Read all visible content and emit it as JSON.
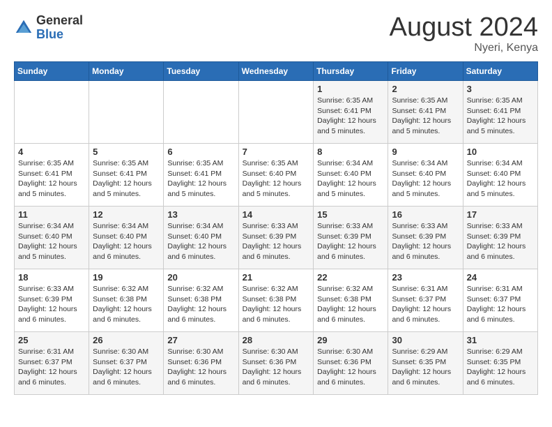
{
  "header": {
    "logo_general": "General",
    "logo_blue": "Blue",
    "month_year": "August 2024",
    "location": "Nyeri, Kenya"
  },
  "weekdays": [
    "Sunday",
    "Monday",
    "Tuesday",
    "Wednesday",
    "Thursday",
    "Friday",
    "Saturday"
  ],
  "weeks": [
    [
      {
        "day": "",
        "info": ""
      },
      {
        "day": "",
        "info": ""
      },
      {
        "day": "",
        "info": ""
      },
      {
        "day": "",
        "info": ""
      },
      {
        "day": "1",
        "info": "Sunrise: 6:35 AM\nSunset: 6:41 PM\nDaylight: 12 hours and 5 minutes."
      },
      {
        "day": "2",
        "info": "Sunrise: 6:35 AM\nSunset: 6:41 PM\nDaylight: 12 hours and 5 minutes."
      },
      {
        "day": "3",
        "info": "Sunrise: 6:35 AM\nSunset: 6:41 PM\nDaylight: 12 hours and 5 minutes."
      }
    ],
    [
      {
        "day": "4",
        "info": "Sunrise: 6:35 AM\nSunset: 6:41 PM\nDaylight: 12 hours and 5 minutes."
      },
      {
        "day": "5",
        "info": "Sunrise: 6:35 AM\nSunset: 6:41 PM\nDaylight: 12 hours and 5 minutes."
      },
      {
        "day": "6",
        "info": "Sunrise: 6:35 AM\nSunset: 6:41 PM\nDaylight: 12 hours and 5 minutes."
      },
      {
        "day": "7",
        "info": "Sunrise: 6:35 AM\nSunset: 6:40 PM\nDaylight: 12 hours and 5 minutes."
      },
      {
        "day": "8",
        "info": "Sunrise: 6:34 AM\nSunset: 6:40 PM\nDaylight: 12 hours and 5 minutes."
      },
      {
        "day": "9",
        "info": "Sunrise: 6:34 AM\nSunset: 6:40 PM\nDaylight: 12 hours and 5 minutes."
      },
      {
        "day": "10",
        "info": "Sunrise: 6:34 AM\nSunset: 6:40 PM\nDaylight: 12 hours and 5 minutes."
      }
    ],
    [
      {
        "day": "11",
        "info": "Sunrise: 6:34 AM\nSunset: 6:40 PM\nDaylight: 12 hours and 5 minutes."
      },
      {
        "day": "12",
        "info": "Sunrise: 6:34 AM\nSunset: 6:40 PM\nDaylight: 12 hours and 6 minutes."
      },
      {
        "day": "13",
        "info": "Sunrise: 6:34 AM\nSunset: 6:40 PM\nDaylight: 12 hours and 6 minutes."
      },
      {
        "day": "14",
        "info": "Sunrise: 6:33 AM\nSunset: 6:39 PM\nDaylight: 12 hours and 6 minutes."
      },
      {
        "day": "15",
        "info": "Sunrise: 6:33 AM\nSunset: 6:39 PM\nDaylight: 12 hours and 6 minutes."
      },
      {
        "day": "16",
        "info": "Sunrise: 6:33 AM\nSunset: 6:39 PM\nDaylight: 12 hours and 6 minutes."
      },
      {
        "day": "17",
        "info": "Sunrise: 6:33 AM\nSunset: 6:39 PM\nDaylight: 12 hours and 6 minutes."
      }
    ],
    [
      {
        "day": "18",
        "info": "Sunrise: 6:33 AM\nSunset: 6:39 PM\nDaylight: 12 hours and 6 minutes."
      },
      {
        "day": "19",
        "info": "Sunrise: 6:32 AM\nSunset: 6:38 PM\nDaylight: 12 hours and 6 minutes."
      },
      {
        "day": "20",
        "info": "Sunrise: 6:32 AM\nSunset: 6:38 PM\nDaylight: 12 hours and 6 minutes."
      },
      {
        "day": "21",
        "info": "Sunrise: 6:32 AM\nSunset: 6:38 PM\nDaylight: 12 hours and 6 minutes."
      },
      {
        "day": "22",
        "info": "Sunrise: 6:32 AM\nSunset: 6:38 PM\nDaylight: 12 hours and 6 minutes."
      },
      {
        "day": "23",
        "info": "Sunrise: 6:31 AM\nSunset: 6:37 PM\nDaylight: 12 hours and 6 minutes."
      },
      {
        "day": "24",
        "info": "Sunrise: 6:31 AM\nSunset: 6:37 PM\nDaylight: 12 hours and 6 minutes."
      }
    ],
    [
      {
        "day": "25",
        "info": "Sunrise: 6:31 AM\nSunset: 6:37 PM\nDaylight: 12 hours and 6 minutes."
      },
      {
        "day": "26",
        "info": "Sunrise: 6:30 AM\nSunset: 6:37 PM\nDaylight: 12 hours and 6 minutes."
      },
      {
        "day": "27",
        "info": "Sunrise: 6:30 AM\nSunset: 6:36 PM\nDaylight: 12 hours and 6 minutes."
      },
      {
        "day": "28",
        "info": "Sunrise: 6:30 AM\nSunset: 6:36 PM\nDaylight: 12 hours and 6 minutes."
      },
      {
        "day": "29",
        "info": "Sunrise: 6:30 AM\nSunset: 6:36 PM\nDaylight: 12 hours and 6 minutes."
      },
      {
        "day": "30",
        "info": "Sunrise: 6:29 AM\nSunset: 6:35 PM\nDaylight: 12 hours and 6 minutes."
      },
      {
        "day": "31",
        "info": "Sunrise: 6:29 AM\nSunset: 6:35 PM\nDaylight: 12 hours and 6 minutes."
      }
    ]
  ]
}
